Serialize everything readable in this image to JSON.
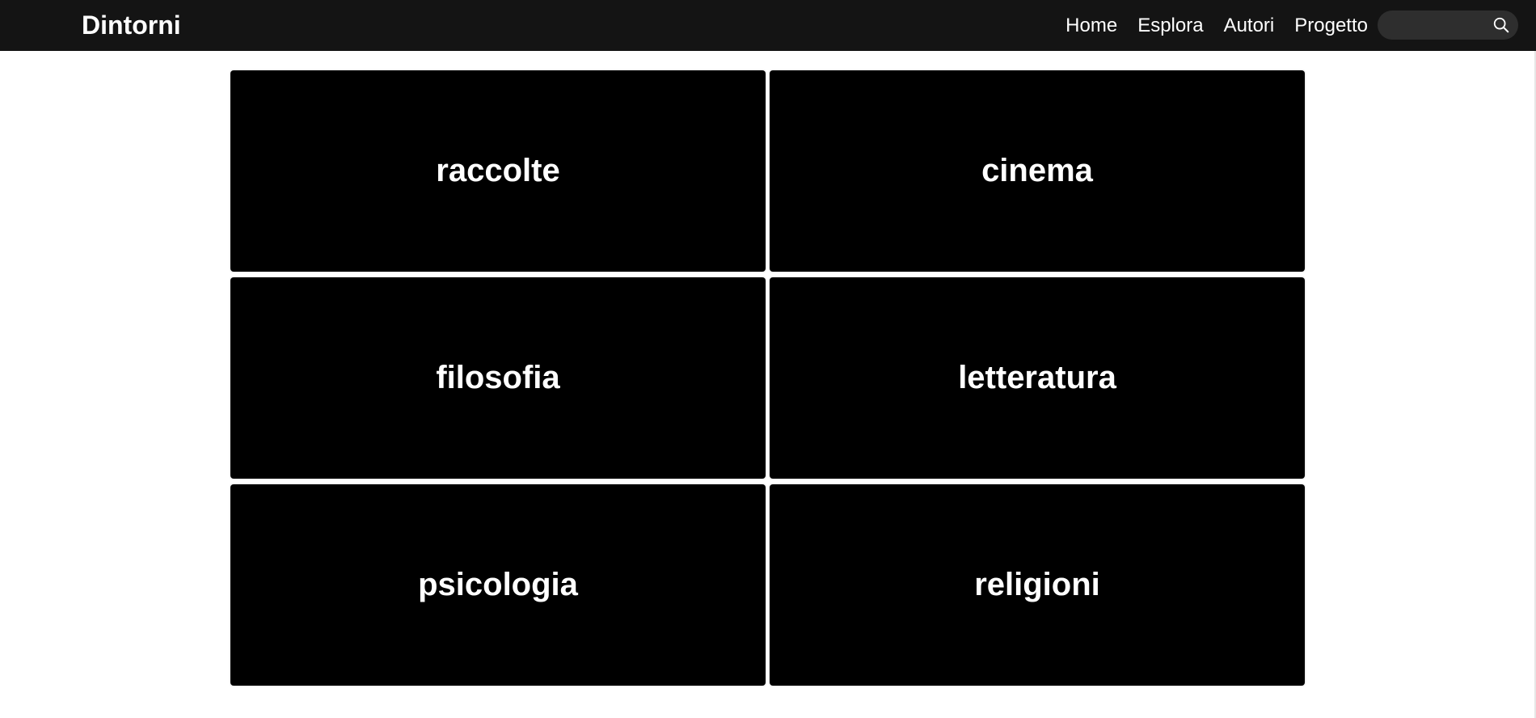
{
  "header": {
    "brand": "Dintorni",
    "nav": [
      {
        "label": "Home"
      },
      {
        "label": "Esplora"
      },
      {
        "label": "Autori"
      },
      {
        "label": "Progetto"
      }
    ],
    "search": {
      "value": "",
      "placeholder": "",
      "icon": "search-icon"
    },
    "background_color": "#141414"
  },
  "categories": [
    {
      "label": "raccolte"
    },
    {
      "label": "cinema"
    },
    {
      "label": "filosofia"
    },
    {
      "label": "letteratura"
    },
    {
      "label": "psicologia"
    },
    {
      "label": "religioni"
    }
  ],
  "tile_color": "#000000"
}
